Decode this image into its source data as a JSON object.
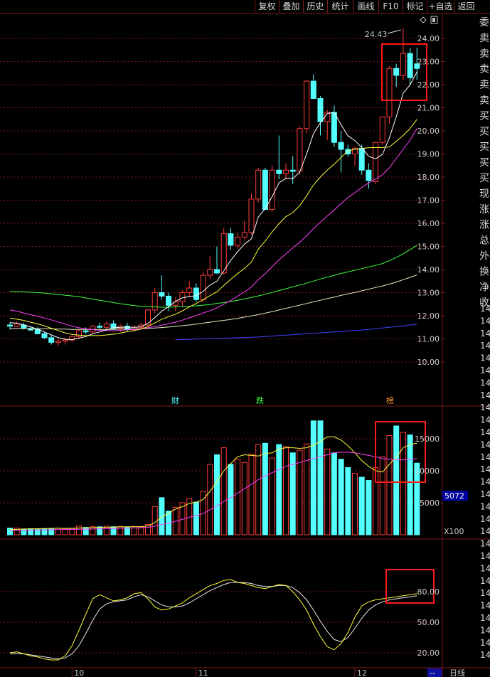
{
  "toolbar": {
    "buttons": [
      "复权",
      "叠加",
      "历史",
      "统计",
      "画线",
      "F10",
      "标记",
      "+自选",
      "返回"
    ]
  },
  "price_panel": {
    "y_ticks": [
      "24.00",
      "23.00",
      "22.00",
      "21.00",
      "20.00",
      "19.00",
      "18.00",
      "17.00",
      "16.00",
      "15.00",
      "14.00",
      "13.00",
      "12.00",
      "11.00",
      "10.00"
    ],
    "high_label": "24.43",
    "event_labels": [
      "财",
      "跌",
      "榜"
    ]
  },
  "volume_panel": {
    "y_ticks": [
      "15000",
      "10000",
      "5000"
    ],
    "current_value": "5072",
    "unit": "X100"
  },
  "kdj_panel": {
    "y_ticks": [
      "80.00",
      "50.00",
      "20.00"
    ]
  },
  "x_axis": {
    "labels": [
      "10",
      "11",
      "12"
    ],
    "period": "日线",
    "corner": "--"
  },
  "side_panel": {
    "labels": [
      "委",
      "卖",
      "卖",
      "卖",
      "卖",
      "卖",
      "买",
      "买",
      "买",
      "买",
      "买",
      "现",
      "涨",
      "涨",
      "总",
      "外",
      "换",
      "净",
      "收"
    ],
    "truncated_values": [
      "14",
      "14",
      "14",
      "14",
      "14",
      "14",
      "14",
      "14",
      "14",
      "14",
      "14",
      "14",
      "14",
      "14",
      "14",
      "14",
      "14",
      "14",
      "14",
      "14",
      "14",
      "14",
      "14",
      "14",
      "14",
      "14",
      "14",
      "14",
      "14"
    ]
  },
  "colors": {
    "up": "#ff3b3b",
    "down": "#54ffff",
    "ma5": "#ffffff",
    "ma10": "#ffff3c",
    "ma20": "#ff40ff",
    "ma60": "#3cff3c",
    "ma120": "#e8e8c0",
    "ma250": "#4040ff",
    "grid": "#7a1d1d",
    "highlight_box": "#ff1a1a"
  },
  "chart_data": {
    "type": "candlestick",
    "x_labels": [
      {
        "label": "10",
        "index": 9
      },
      {
        "label": "11",
        "index": 27
      },
      {
        "label": "12",
        "index": 50
      }
    ],
    "y_range": [
      9.0,
      25.0
    ],
    "candles": [
      [
        11.6,
        11.72,
        11.4,
        11.55
      ],
      [
        11.55,
        11.75,
        11.5,
        11.65
      ],
      [
        11.6,
        11.7,
        11.4,
        11.45
      ],
      [
        11.45,
        11.55,
        11.35,
        11.38
      ],
      [
        11.4,
        11.5,
        11.2,
        11.22
      ],
      [
        11.22,
        11.3,
        11.0,
        11.05
      ],
      [
        11.05,
        11.15,
        10.75,
        10.85
      ],
      [
        10.85,
        11.0,
        10.7,
        10.9
      ],
      [
        10.9,
        11.05,
        10.75,
        10.95
      ],
      [
        10.95,
        11.15,
        10.85,
        11.1
      ],
      [
        11.1,
        11.4,
        11.0,
        11.35
      ],
      [
        11.35,
        11.5,
        11.2,
        11.3
      ],
      [
        11.3,
        11.6,
        11.2,
        11.55
      ],
      [
        11.55,
        11.7,
        11.4,
        11.5
      ],
      [
        11.5,
        11.75,
        11.4,
        11.65
      ],
      [
        11.65,
        11.8,
        11.4,
        11.45
      ],
      [
        11.45,
        11.65,
        11.3,
        11.55
      ],
      [
        11.55,
        11.7,
        11.3,
        11.4
      ],
      [
        11.4,
        11.6,
        11.3,
        11.5
      ],
      [
        11.5,
        11.7,
        11.4,
        11.6
      ],
      [
        11.6,
        12.3,
        11.55,
        12.25
      ],
      [
        12.25,
        13.2,
        12.1,
        13.0
      ],
      [
        13.0,
        13.75,
        12.7,
        12.85
      ],
      [
        12.85,
        13.0,
        12.2,
        12.45
      ],
      [
        12.45,
        12.8,
        12.2,
        12.6
      ],
      [
        12.6,
        13.1,
        12.4,
        13.0
      ],
      [
        13.0,
        13.5,
        12.8,
        13.2
      ],
      [
        13.2,
        13.4,
        12.6,
        12.7
      ],
      [
        12.7,
        13.9,
        12.6,
        13.75
      ],
      [
        13.75,
        14.6,
        13.6,
        14.0
      ],
      [
        14.0,
        15.0,
        13.8,
        13.85
      ],
      [
        13.85,
        15.8,
        13.8,
        15.55
      ],
      [
        15.55,
        15.8,
        14.85,
        15.05
      ],
      [
        15.05,
        15.6,
        14.9,
        15.4
      ],
      [
        15.4,
        16.1,
        15.3,
        15.6
      ],
      [
        15.6,
        17.3,
        15.5,
        17.05
      ],
      [
        17.05,
        18.4,
        16.9,
        18.3
      ],
      [
        18.3,
        18.4,
        16.6,
        16.6
      ],
      [
        16.6,
        18.5,
        16.5,
        18.3
      ],
      [
        18.3,
        19.8,
        17.9,
        18.15
      ],
      [
        18.15,
        18.6,
        17.9,
        18.3
      ],
      [
        18.3,
        18.9,
        17.7,
        18.25
      ],
      [
        18.25,
        20.2,
        18.1,
        20.1
      ],
      [
        20.1,
        22.2,
        19.9,
        22.15
      ],
      [
        22.15,
        22.45,
        21.5,
        21.4
      ],
      [
        21.4,
        21.5,
        19.8,
        20.4
      ],
      [
        20.4,
        20.9,
        19.6,
        20.8
      ],
      [
        20.8,
        21.1,
        19.3,
        19.5
      ],
      [
        19.5,
        20.0,
        18.2,
        19.2
      ],
      [
        19.2,
        19.4,
        18.9,
        19.0
      ],
      [
        19.0,
        19.3,
        18.5,
        19.25
      ],
      [
        19.25,
        19.4,
        18.1,
        18.3
      ],
      [
        18.3,
        18.6,
        17.5,
        17.85
      ],
      [
        17.8,
        19.5,
        17.7,
        19.5
      ],
      [
        19.5,
        20.6,
        19.4,
        20.6
      ],
      [
        20.6,
        22.8,
        20.3,
        22.7
      ],
      [
        22.7,
        22.9,
        21.9,
        22.4
      ],
      [
        22.4,
        24.43,
        22.2,
        23.35
      ],
      [
        23.35,
        23.6,
        22.0,
        22.3
      ],
      [
        22.9,
        23.6,
        22.2,
        22.7
      ]
    ],
    "ma5": [
      11.7,
      11.68,
      11.6,
      11.52,
      11.42,
      11.3,
      11.17,
      11.05,
      10.98,
      10.97,
      11.03,
      11.1,
      11.22,
      11.3,
      11.39,
      11.48,
      11.5,
      11.51,
      11.5,
      11.52,
      11.67,
      11.92,
      12.2,
      12.39,
      12.62,
      12.78,
      12.83,
      12.87,
      13.05,
      13.33,
      13.5,
      13.94,
      14.4,
      14.77,
      15.1,
      15.33,
      16.27,
      16.63,
      17.15,
      17.75,
      17.95,
      17.93,
      18.22,
      18.99,
      19.88,
      20.35,
      20.75,
      20.8,
      20.26,
      19.78,
      19.58,
      19.28,
      18.9,
      18.79,
      18.98,
      19.7,
      20.61,
      21.63,
      21.99,
      22.55
    ],
    "ma10": [
      11.9,
      11.85,
      11.8,
      11.72,
      11.65,
      11.56,
      11.46,
      11.36,
      11.26,
      11.19,
      11.16,
      11.14,
      11.14,
      11.14,
      11.17,
      11.2,
      11.25,
      11.31,
      11.36,
      11.42,
      11.53,
      11.69,
      11.85,
      11.96,
      12.07,
      12.21,
      12.38,
      12.53,
      12.69,
      12.87,
      13.03,
      13.31,
      13.58,
      13.82,
      14.05,
      14.32,
      14.88,
      15.23,
      15.63,
      15.98,
      16.29,
      16.46,
      16.76,
      17.19,
      17.66,
      18.0,
      18.3,
      18.56,
      18.85,
      19.13,
      19.2,
      19.24,
      19.27,
      19.28,
      19.28,
      19.3,
      19.55,
      19.8,
      20.1,
      20.5
    ],
    "ma20": [
      12.25,
      12.2,
      12.12,
      12.05,
      11.98,
      11.9,
      11.82,
      11.73,
      11.64,
      11.55,
      11.48,
      11.43,
      11.4,
      11.37,
      11.36,
      11.35,
      11.37,
      11.39,
      11.41,
      11.44,
      11.48,
      11.53,
      11.59,
      11.66,
      11.72,
      11.81,
      11.91,
      12.01,
      12.12,
      12.22,
      12.34,
      12.5,
      12.66,
      12.85,
      13.03,
      13.24,
      13.55,
      13.82,
      14.12,
      14.42,
      14.68,
      14.93,
      15.18,
      15.46,
      15.77,
      16.05,
      16.32,
      16.58,
      16.85,
      17.12,
      17.33,
      17.55,
      17.75,
      17.92,
      18.1,
      18.4,
      18.8,
      19.2,
      19.6,
      20.1
    ],
    "ma60": [
      13.05,
      13.04,
      13.03,
      13.02,
      13.0,
      12.98,
      12.95,
      12.92,
      12.89,
      12.86,
      12.82,
      12.77,
      12.72,
      12.67,
      12.62,
      12.57,
      12.52,
      12.48,
      12.44,
      12.41,
      12.39,
      12.38,
      12.37,
      12.37,
      12.38,
      12.39,
      12.41,
      12.43,
      12.46,
      12.49,
      12.53,
      12.57,
      12.62,
      12.67,
      12.73,
      12.79,
      12.86,
      12.93,
      13.01,
      13.09,
      13.17,
      13.25,
      13.33,
      13.41,
      13.5,
      13.59,
      13.67,
      13.75,
      13.83,
      13.9,
      13.97,
      14.04,
      14.11,
      14.18,
      14.26,
      14.38,
      14.52,
      14.68,
      14.86,
      15.05
    ],
    "ma120": [
      11.45,
      11.45,
      11.45,
      11.44,
      11.44,
      11.43,
      11.43,
      11.42,
      11.42,
      11.41,
      11.41,
      11.41,
      11.41,
      11.41,
      11.41,
      11.41,
      11.42,
      11.42,
      11.43,
      11.44,
      11.45,
      11.47,
      11.49,
      11.51,
      11.54,
      11.57,
      11.6,
      11.64,
      11.68,
      11.72,
      11.76,
      11.8,
      11.84,
      11.89,
      11.94,
      11.99,
      12.05,
      12.11,
      12.18,
      12.25,
      12.32,
      12.39,
      12.46,
      12.53,
      12.6,
      12.67,
      12.74,
      12.81,
      12.88,
      12.95,
      13.01,
      13.08,
      13.15,
      13.22,
      13.29,
      13.37,
      13.46,
      13.56,
      13.66,
      13.77
    ],
    "ma250_start_index": 24,
    "ma250": [
      10.96,
      10.97,
      10.98,
      10.99,
      11.0,
      11.01,
      11.02,
      11.03,
      11.04,
      11.05,
      11.06,
      11.07,
      11.08,
      11.1,
      11.12,
      11.14,
      11.16,
      11.18,
      11.2,
      11.22,
      11.24,
      11.26,
      11.28,
      11.3,
      11.32,
      11.34,
      11.36,
      11.38,
      11.41,
      11.44,
      11.47,
      11.5,
      11.53,
      11.56,
      11.6,
      11.64
    ],
    "volume": {
      "y_range": [
        0,
        18000
      ],
      "values": [
        1050,
        1050,
        900,
        950,
        900,
        950,
        1000,
        1050,
        950,
        1050,
        1350,
        1150,
        1300,
        1250,
        1350,
        1250,
        1300,
        1200,
        1300,
        1200,
        1600,
        4400,
        5800,
        3700,
        4300,
        5000,
        5700,
        5100,
        6800,
        11000,
        12500,
        13600,
        11000,
        11800,
        11300,
        12600,
        14100,
        14300,
        12000,
        14100,
        13800,
        12800,
        13200,
        14200,
        17800,
        17800,
        13400,
        12800,
        11800,
        10500,
        9600,
        9000,
        8500,
        10500,
        12200,
        15500,
        17000,
        16000,
        15600,
        11200
      ],
      "ma_a": [
        800,
        850,
        900,
        920,
        950,
        980,
        1000,
        1020,
        1000,
        1000,
        1050,
        1080,
        1120,
        1150,
        1180,
        1200,
        1230,
        1250,
        1260,
        1280,
        1380,
        1900,
        2800,
        3400,
        4000,
        4400,
        4900,
        5100,
        5500,
        6800,
        8300,
        10000,
        11100,
        12200,
        12500,
        12400,
        12300,
        12700,
        12800,
        13400,
        13600,
        13600,
        13500,
        13600,
        14000,
        14600,
        15300,
        15300,
        14800,
        13900,
        12800,
        11600,
        10700,
        10000,
        9800,
        11000,
        12100,
        13600,
        14100,
        14300
      ],
      "ma_b": [
        700,
        710,
        720,
        730,
        750,
        760,
        780,
        800,
        820,
        840,
        860,
        880,
        900,
        920,
        950,
        980,
        1010,
        1040,
        1070,
        1100,
        1150,
        1350,
        1600,
        1800,
        2100,
        2400,
        2750,
        3000,
        3300,
        3900,
        4500,
        5200,
        5800,
        6500,
        7200,
        7900,
        8600,
        9200,
        9700,
        10200,
        10700,
        11000,
        11300,
        11600,
        11900,
        12200,
        12500,
        12800,
        12900,
        12900,
        12800,
        12600,
        12400,
        12200,
        11900,
        11800,
        11700,
        11700,
        11800,
        11900
      ]
    },
    "kdj": {
      "y_range": [
        10,
        100
      ],
      "k": [
        20,
        21,
        19,
        17,
        16,
        14,
        13,
        13,
        17,
        27,
        42,
        58,
        73,
        77,
        74,
        71,
        72,
        74,
        78,
        79,
        73,
        65,
        62,
        63,
        66,
        69,
        74,
        78,
        82,
        86,
        88,
        91,
        92,
        89,
        88,
        86,
        84,
        83,
        85,
        87,
        86,
        80,
        72,
        62,
        48,
        36,
        26,
        23,
        29,
        40,
        55,
        66,
        70,
        72,
        73,
        74,
        75,
        76,
        77,
        78
      ],
      "d": [
        19,
        19,
        19,
        18,
        17,
        16,
        15,
        14,
        15,
        19,
        27,
        39,
        52,
        63,
        68,
        70,
        71,
        72,
        75,
        77,
        75,
        71,
        67,
        65,
        65,
        66,
        69,
        73,
        77,
        81,
        84,
        87,
        89,
        89,
        89,
        88,
        86,
        85,
        85,
        86,
        86,
        84,
        79,
        72,
        62,
        51,
        41,
        33,
        31,
        35,
        44,
        54,
        62,
        67,
        70,
        72,
        73,
        74,
        75,
        76
      ]
    }
  }
}
